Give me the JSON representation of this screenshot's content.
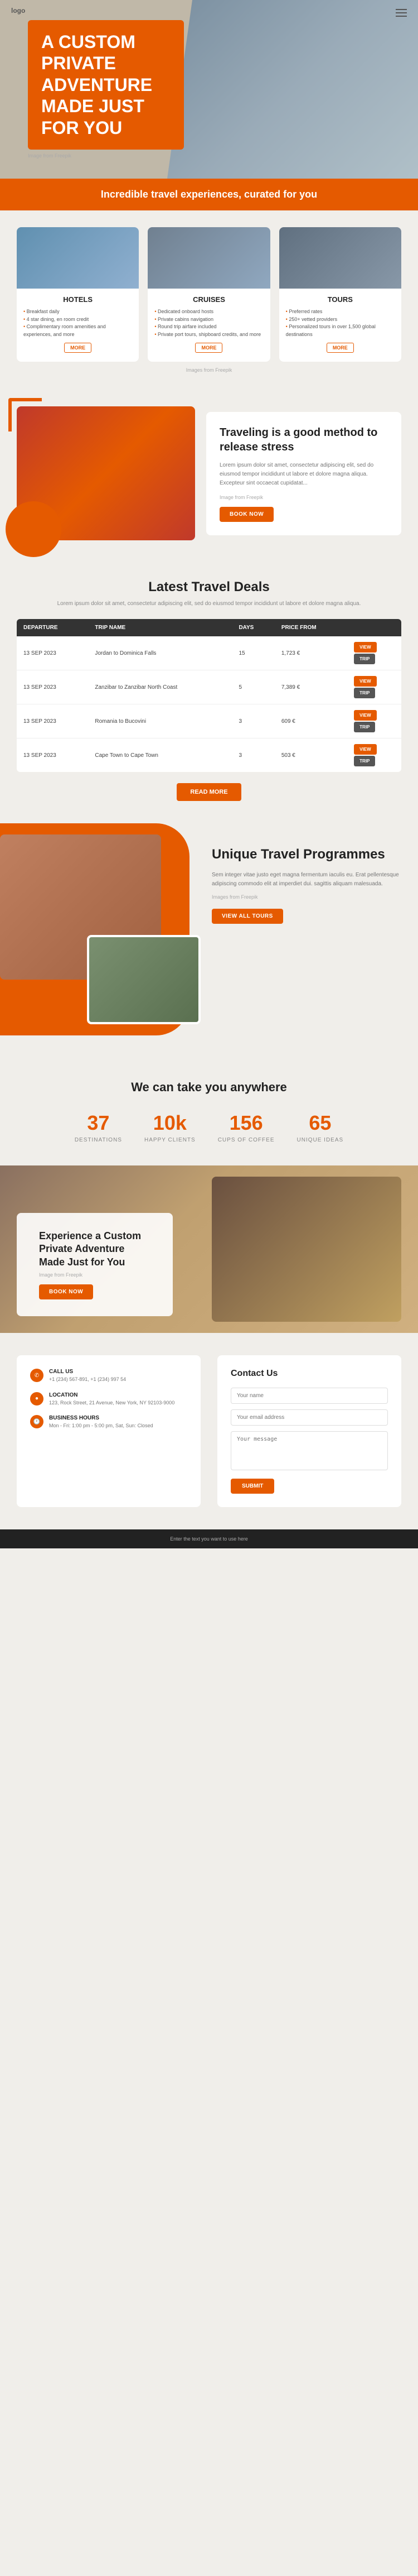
{
  "logo": "logo",
  "hero": {
    "title": "A CUSTOM PRIVATE ADVENTURE MADE JUST FOR YOU",
    "image_credit": "Image from Freepik"
  },
  "section1": {
    "subtitle": "Incredible travel experiences, curated for you"
  },
  "cards": {
    "cards_credit": "Images from Freepik",
    "hotels": {
      "title": "HOTELS",
      "features": [
        "Breakfast daily",
        "4 star dining, en room credit",
        "Complimentary room amenities and experiences, and more"
      ],
      "more": "MORE"
    },
    "cruises": {
      "title": "CRUISES",
      "features": [
        "Dedicated onboard hosts",
        "Private cabins navigation",
        "Round trip airfare included",
        "Private port tours, shipboard credits, and more"
      ],
      "more": "MORE"
    },
    "tours": {
      "title": "TOURS",
      "features": [
        "Preferred rates",
        "250+ vetted providers",
        "Personalized tours in over 1,500 global destinations"
      ],
      "more": "MORE"
    }
  },
  "stress": {
    "title": "Traveling is a good method to release stress",
    "body": "Lorem ipsum dolor sit amet, consectetur adipiscing elit, sed do eiusmod tempor incididunt ut labore et dolore magna aliqua. Excepteur sint occaecat cupidatat...",
    "image_credit": "Image from Freepik",
    "book_now": "BOOK NOW"
  },
  "deals": {
    "title": "Latest Travel Deals",
    "subtitle": "Lorem ipsum dolor sit amet, consectetur adipiscing elit, sed do eiusmod tempor incididunt ut labore et dolore magna aliqua.",
    "columns": [
      "DEPARTURE",
      "TRIP NAME",
      "DAYS",
      "PRICE FROM",
      ""
    ],
    "rows": [
      {
        "departure": "13 SEP 2023",
        "trip_name": "Jordan to Dominica Falls",
        "days": "15",
        "price": "1,723 €",
        "btn1": "VIEW",
        "btn2": "TRIP"
      },
      {
        "departure": "13 SEP 2023",
        "trip_name": "Zanzibar to Zanzibar North Coast",
        "days": "5",
        "price": "7,389 €",
        "btn1": "VIEW",
        "btn2": "TRIP"
      },
      {
        "departure": "13 SEP 2023",
        "trip_name": "Romania to Bucovini",
        "days": "3",
        "price": "609 €",
        "btn1": "VIEW",
        "btn2": "TRIP"
      },
      {
        "departure": "13 SEP 2023",
        "trip_name": "Cape Town to Cape Town",
        "days": "3",
        "price": "503 €",
        "btn1": "VIEW",
        "btn2": "TRIP"
      }
    ],
    "read_more": "READ MORE"
  },
  "programmes": {
    "title": "Unique Travel Programmes",
    "body": "Sem integer vitae justo eget magna fermentum iaculis eu. Erat pellentesque adipiscing commodo elit at imperdiet dui. sagittis aliquam malesuada.",
    "image_credit": "Images from Freepik",
    "btn": "VIEW ALL TOURS"
  },
  "stats": {
    "title": "We can take you anywhere",
    "items": [
      {
        "number": "37",
        "label": "DESTINATIONS"
      },
      {
        "number": "10k",
        "label": "HAPPY CLIENTS"
      },
      {
        "number": "156",
        "label": "CUPS OF COFFEE"
      },
      {
        "number": "65",
        "label": "UNIQUE IDEAS"
      }
    ]
  },
  "adventure": {
    "title": "Experience a Custom Private Adventure Made Just for You",
    "image_credit": "Image from Freepik",
    "btn": "BOOK NOW"
  },
  "footer": {
    "left": {
      "call_label": "CALL US",
      "call_value": "+1 (234) 567-891, +1 (234) 997 54",
      "location_label": "LOCATION",
      "location_value": "123, Rock Street, 21 Avenue, New York, NY 92103-9000",
      "hours_label": "BUSINESS HOURS",
      "hours_value": "Mon - Fri: 1:00 pm - 5:00 pm, Sat, Sun: Closed"
    },
    "right": {
      "title": "Contact Us",
      "name_placeholder": "Your name",
      "email_placeholder": "Your email address",
      "message_placeholder": "Your message",
      "submit": "SUBMIT"
    }
  },
  "bottom_bar": "Enter the text you want to use here"
}
